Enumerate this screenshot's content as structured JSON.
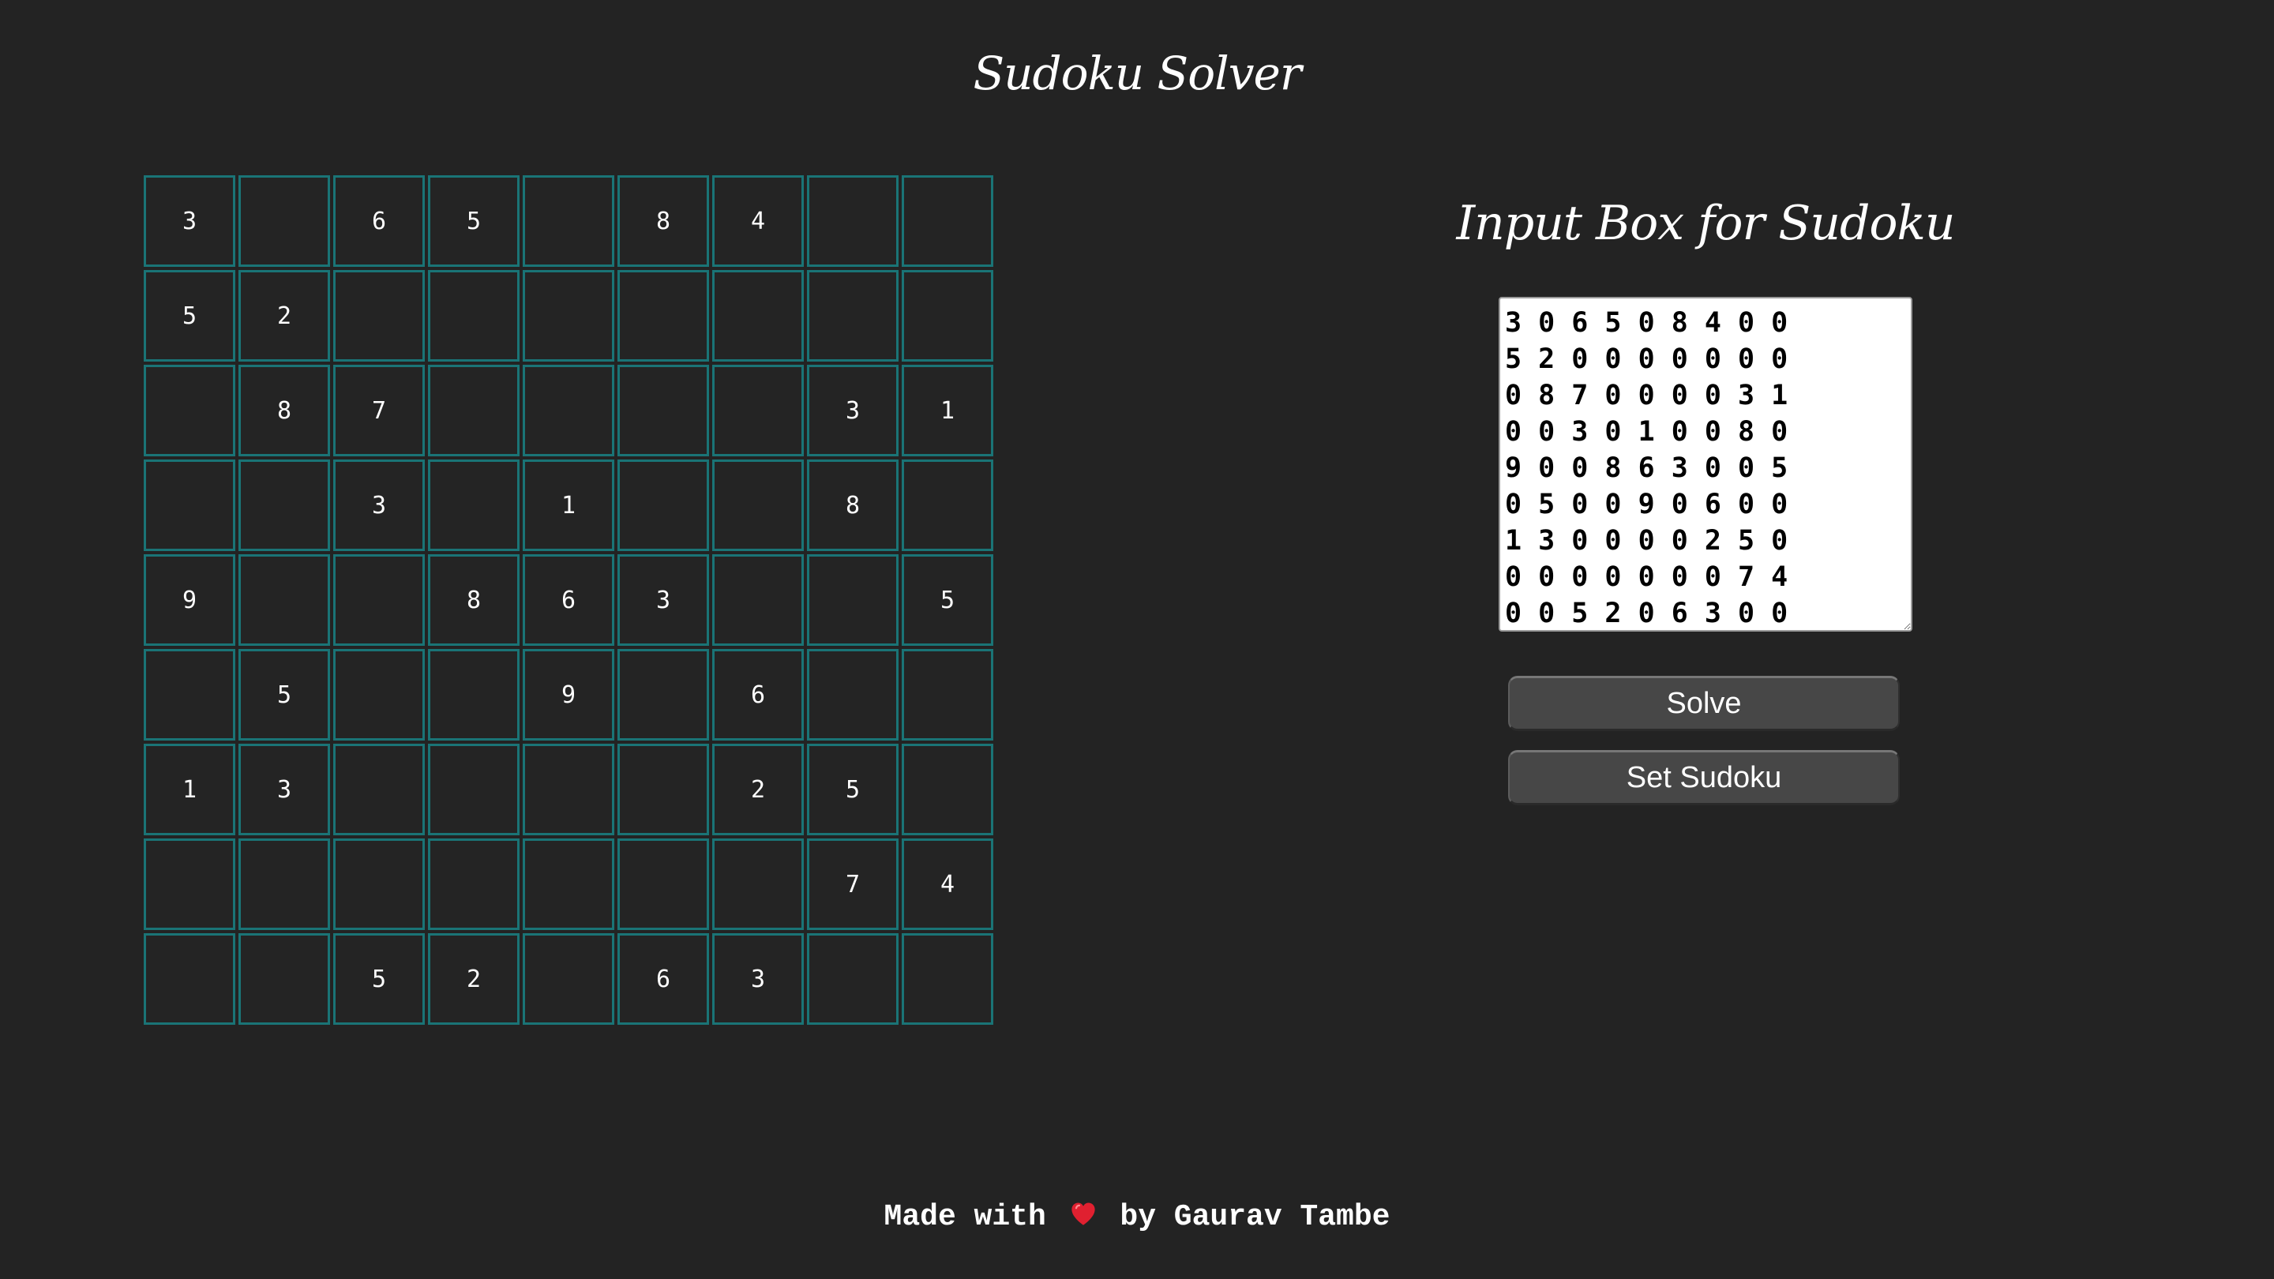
{
  "header": {
    "title": "Sudoku Solver"
  },
  "board": {
    "rows": [
      [
        "3",
        "",
        "6",
        "5",
        "",
        "8",
        "4",
        "",
        ""
      ],
      [
        "5",
        "2",
        "",
        "",
        "",
        "",
        "",
        "",
        ""
      ],
      [
        "",
        "8",
        "7",
        "",
        "",
        "",
        "",
        "3",
        "1"
      ],
      [
        "",
        "",
        "3",
        "",
        "1",
        "",
        "",
        "8",
        ""
      ],
      [
        "9",
        "",
        "",
        "8",
        "6",
        "3",
        "",
        "",
        "5"
      ],
      [
        "",
        "5",
        "",
        "",
        "9",
        "",
        "6",
        "",
        ""
      ],
      [
        "1",
        "3",
        "",
        "",
        "",
        "",
        "2",
        "5",
        ""
      ],
      [
        "",
        "",
        "",
        "",
        "",
        "",
        "",
        "7",
        "4"
      ],
      [
        "",
        "",
        "5",
        "2",
        "",
        "6",
        "3",
        "",
        ""
      ]
    ]
  },
  "input_panel": {
    "title": "Input Box for Sudoku",
    "value": "3 0 6 5 0 8 4 0 0\n5 2 0 0 0 0 0 0 0\n0 8 7 0 0 0 0 3 1\n0 0 3 0 1 0 0 8 0\n9 0 0 8 6 3 0 0 5\n0 5 0 0 9 0 6 0 0\n1 3 0 0 0 0 2 5 0\n0 0 0 0 0 0 0 7 4\n0 0 5 2 0 6 3 0 0",
    "solve_label": "Solve",
    "set_label": "Set Sudoku"
  },
  "footer": {
    "prefix": "Made with",
    "suffix": "by Gaurav Tambe",
    "icon": "heart-icon"
  },
  "colors": {
    "background": "#232323",
    "cell_border": "#1a7476",
    "heart": "#e02030"
  }
}
